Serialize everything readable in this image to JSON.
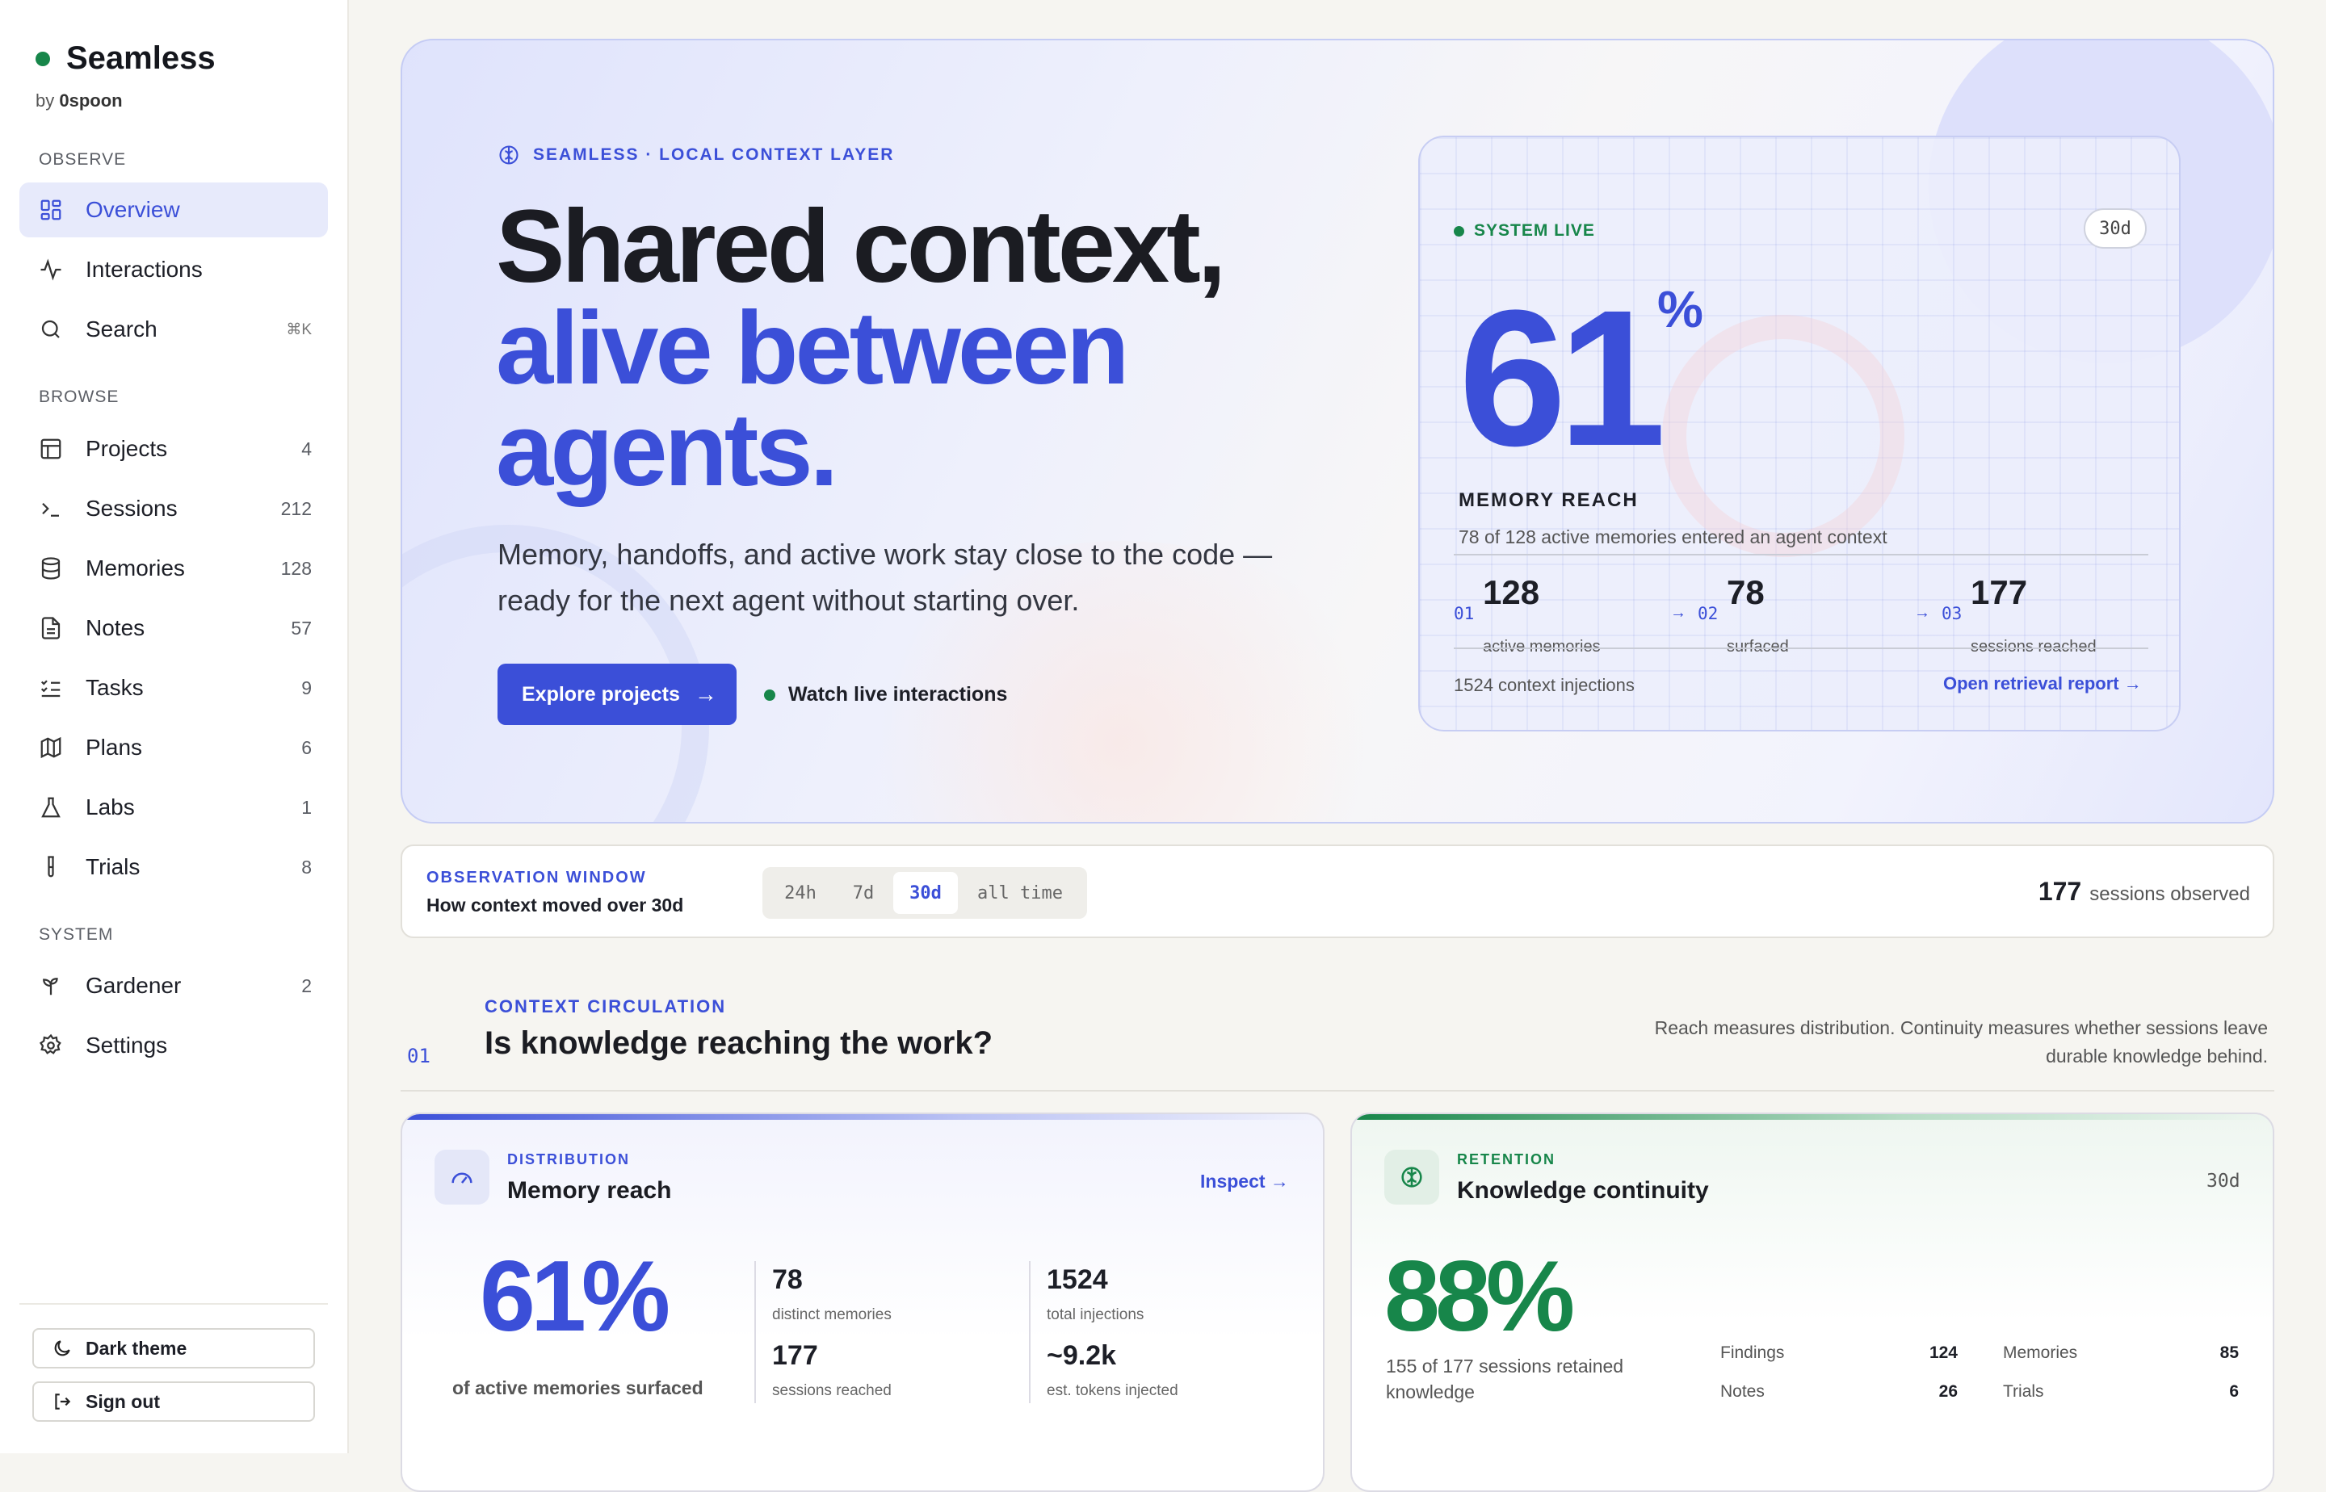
{
  "sidebar": {
    "brand": "Seamless",
    "by": "by",
    "by_org": "0spoon",
    "sections": {
      "observe": "OBSERVE",
      "browse": "BROWSE",
      "system": "SYSTEM"
    },
    "items": [
      {
        "label": "Overview",
        "icon": "grid-icon"
      },
      {
        "label": "Interactions",
        "icon": "activity-icon"
      },
      {
        "label": "Search",
        "icon": "search-icon",
        "shortcut": "⌘K"
      },
      {
        "label": "Projects",
        "count": "4",
        "icon": "table-icon"
      },
      {
        "label": "Sessions",
        "count": "212",
        "icon": "terminal-icon"
      },
      {
        "label": "Memories",
        "count": "128",
        "icon": "database-icon"
      },
      {
        "label": "Notes",
        "count": "57",
        "icon": "file-text-icon"
      },
      {
        "label": "Tasks",
        "count": "9",
        "icon": "list-checks-icon"
      },
      {
        "label": "Plans",
        "count": "6",
        "icon": "map-icon"
      },
      {
        "label": "Labs",
        "count": "1",
        "icon": "flask-icon"
      },
      {
        "label": "Trials",
        "count": "8",
        "icon": "test-tube-icon"
      },
      {
        "label": "Gardener",
        "count": "2",
        "icon": "sprout-icon"
      },
      {
        "label": "Settings",
        "icon": "gear-icon"
      }
    ],
    "dark_theme": "Dark theme",
    "sign_out": "Sign out"
  },
  "hero": {
    "eyebrow": "SEAMLESS · LOCAL CONTEXT LAYER",
    "headline_1": "Shared context,",
    "headline_2": "alive between",
    "headline_3": "agents.",
    "lead": "Memory, handoffs, and active work stay close to the code — ready for the next agent without starting over.",
    "cta": "Explore projects",
    "secondary": "Watch live interactions"
  },
  "live": {
    "status": "SYSTEM LIVE",
    "range": "30d",
    "value": "61",
    "unit": "%",
    "title": "MEMORY REACH",
    "subtitle": "78 of 128 active memories entered an agent context",
    "stats": [
      {
        "num": "01",
        "value": "128",
        "label": "active memories"
      },
      {
        "num": "02",
        "value": "78",
        "label": "surfaced"
      },
      {
        "num": "03",
        "value": "177",
        "label": "sessions reached"
      }
    ],
    "arrow": "→",
    "injections": "1524 context injections",
    "report": "Open retrieval report"
  },
  "observation": {
    "kicker": "OBSERVATION WINDOW",
    "title": "How context moved over 30d",
    "ranges": [
      "24h",
      "7d",
      "30d",
      "all time"
    ],
    "selected": "30d",
    "sessions": "177",
    "sessions_label": "sessions observed"
  },
  "circulation": {
    "kicker": "CONTEXT CIRCULATION",
    "number": "01",
    "title": "Is knowledge reaching the work?",
    "note": "Reach measures distribution. Continuity measures whether sessions leave durable knowledge behind."
  },
  "reach_card": {
    "kicker": "DISTRIBUTION",
    "title": "Memory reach",
    "action": "Inspect",
    "value": "61%",
    "caption": "of active memories surfaced",
    "metrics": [
      {
        "value": "78",
        "label": "distinct memories"
      },
      {
        "value": "1524",
        "label": "total injections"
      },
      {
        "value": "177",
        "label": "sessions reached"
      },
      {
        "value": "~9.2k",
        "label": "est. tokens injected"
      }
    ]
  },
  "continuity_card": {
    "kicker": "RETENTION",
    "title": "Knowledge continuity",
    "range": "30d",
    "value": "88%",
    "caption": "155 of 177 sessions retained knowledge",
    "facts": [
      {
        "label": "Findings",
        "value": "124"
      },
      {
        "label": "Memories",
        "value": "85"
      },
      {
        "label": "Notes",
        "value": "26"
      },
      {
        "label": "Trials",
        "value": "6"
      }
    ]
  },
  "colors": {
    "accent": "#3b4fd8",
    "success": "#17864a",
    "background": "#f6f5f1"
  }
}
